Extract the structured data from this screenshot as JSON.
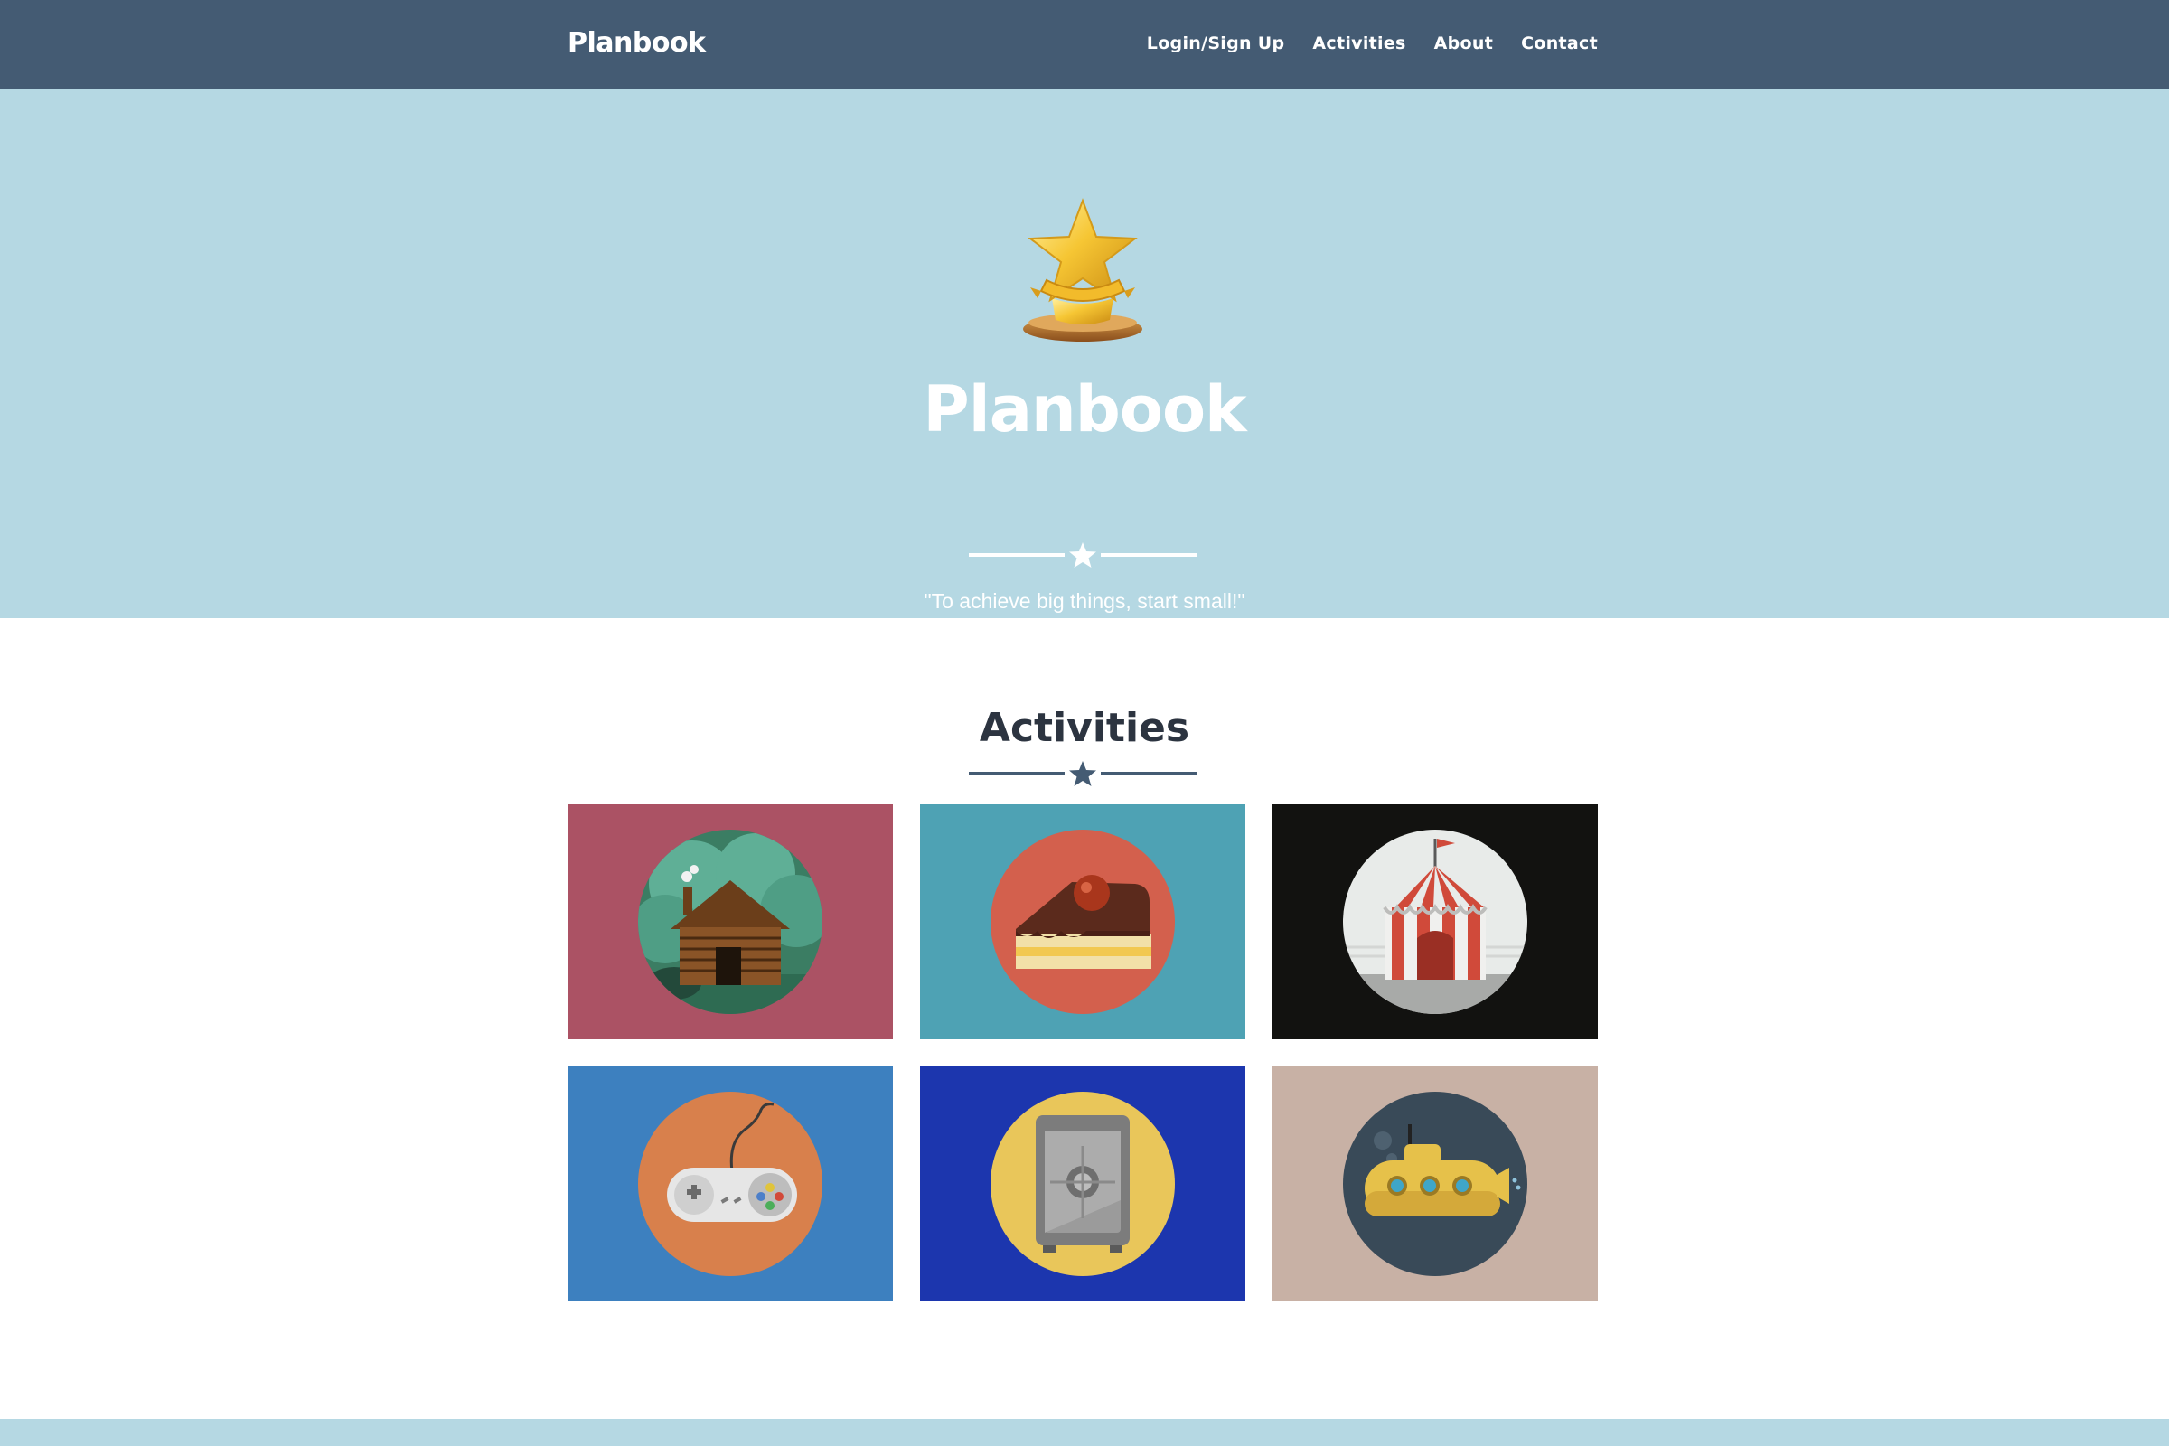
{
  "navbar": {
    "brand": "Planbook",
    "links": [
      {
        "label": "Login/Sign Up"
      },
      {
        "label": "Activities"
      },
      {
        "label": "About"
      },
      {
        "label": "Contact"
      }
    ]
  },
  "hero": {
    "title": "Planbook",
    "tagline": "\"To achieve big things, start small!\""
  },
  "activities": {
    "title": "Activities",
    "tiles": [
      {
        "icon": "log-cabin-icon",
        "bg": "#ab5264",
        "circle": "#3b7d63"
      },
      {
        "icon": "cake-slice-icon",
        "bg": "#4ea2b4",
        "circle": "#d3604d"
      },
      {
        "icon": "circus-tent-icon",
        "bg": "#121210",
        "circle": "#e8ebe9"
      },
      {
        "icon": "game-controller-icon",
        "bg": "#3d80bf",
        "circle": "#d8804c"
      },
      {
        "icon": "safe-icon",
        "bg": "#1c36ae",
        "circle": "#e9c65a"
      },
      {
        "icon": "submarine-icon",
        "bg": "#c8b1a5",
        "circle": "#394a58"
      }
    ]
  },
  "colors": {
    "navbar": "#445b73",
    "hero": "#b5d8e3",
    "accent": "#445b73"
  }
}
